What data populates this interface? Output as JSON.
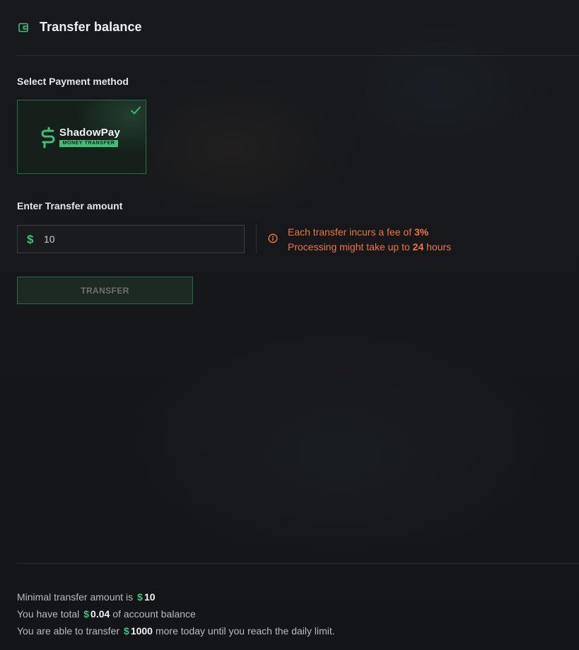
{
  "header": {
    "title": "Transfer balance",
    "icon": "wallet-icon"
  },
  "payment": {
    "label": "Select Payment method",
    "method_name": "ShadowPay",
    "method_tagline": "MONEY TRANSFER",
    "selected": true
  },
  "amount": {
    "label": "Enter Transfer amount",
    "currency_symbol": "$",
    "value": "10"
  },
  "fee_notice": {
    "line1_prefix": "Each transfer incurs a fee of ",
    "fee_percent": "3%",
    "line2_prefix": "Processing might take up to ",
    "hours": "24",
    "line2_suffix": " hours"
  },
  "actions": {
    "transfer_label": "TRANSFER"
  },
  "limits": {
    "currency_symbol": "$",
    "min_prefix": "Minimal transfer amount is",
    "min_value": "10",
    "balance_prefix": "You have total",
    "balance_value": "0.04",
    "balance_suffix": "of account balance",
    "daily_prefix": "You are able to transfer",
    "daily_value": "1000",
    "daily_suffix": "more today until you reach the daily limit."
  },
  "colors": {
    "accent_green": "#3fc07a",
    "warning_orange": "#f2743a",
    "background": "#16181c"
  }
}
